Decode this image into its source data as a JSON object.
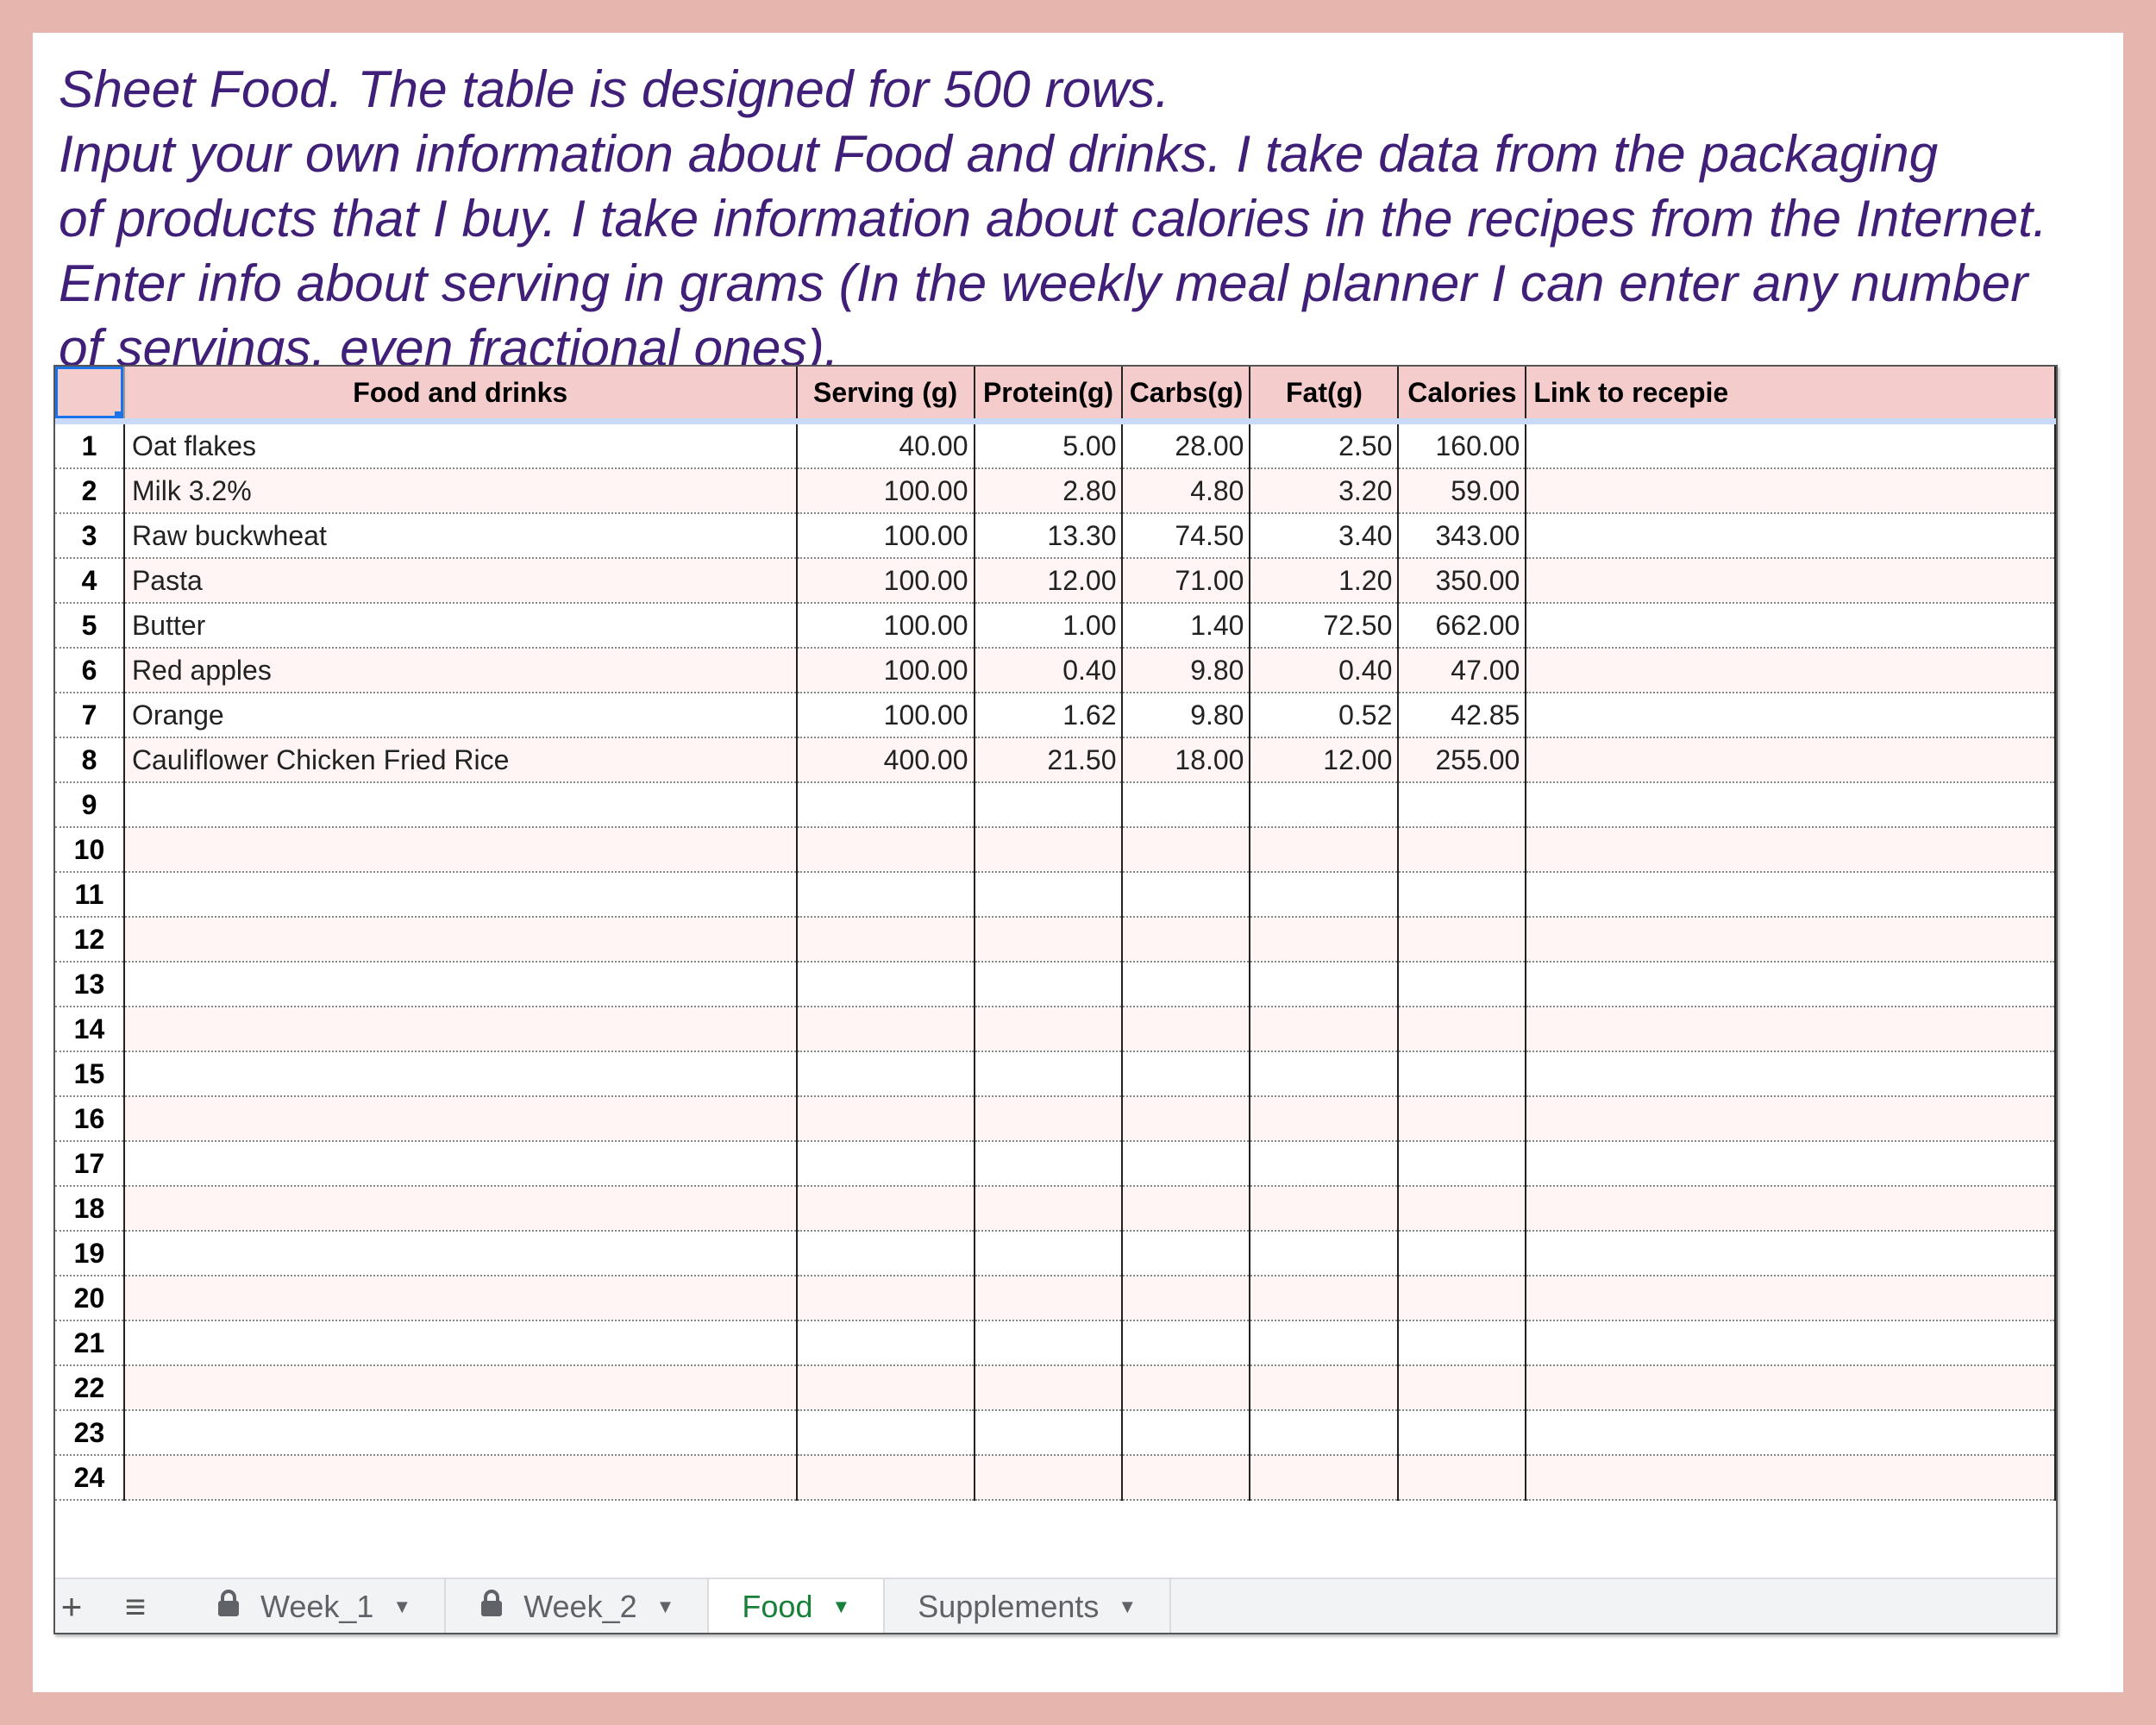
{
  "intro_lines": [
    "Sheet Food. The table is designed for 500 rows.",
    "Input your own information about Food and drinks. I take data from the packaging",
    "of products that I buy. I take information about calories in the recipes from the Internet.",
    "Enter info about serving in grams (In the weekly meal planner I can enter any number",
    "of servings, even fractional ones)."
  ],
  "table": {
    "headers": [
      "Food and drinks",
      "Serving (g)",
      "Protein(g)",
      "Carbs(g)",
      "Fat(g)",
      "Calories",
      "Link to recepie"
    ],
    "rows": [
      {
        "n": "1",
        "food": "Oat flakes",
        "serving": "40.00",
        "protein": "5.00",
        "carbs": "28.00",
        "fat": "2.50",
        "calories": "160.00",
        "link": ""
      },
      {
        "n": "2",
        "food": "Milk 3.2%",
        "serving": "100.00",
        "protein": "2.80",
        "carbs": "4.80",
        "fat": "3.20",
        "calories": "59.00",
        "link": ""
      },
      {
        "n": "3",
        "food": "Raw buckwheat",
        "serving": "100.00",
        "protein": "13.30",
        "carbs": "74.50",
        "fat": "3.40",
        "calories": "343.00",
        "link": ""
      },
      {
        "n": "4",
        "food": "Pasta",
        "serving": "100.00",
        "protein": "12.00",
        "carbs": "71.00",
        "fat": "1.20",
        "calories": "350.00",
        "link": ""
      },
      {
        "n": "5",
        "food": "Butter",
        "serving": "100.00",
        "protein": "1.00",
        "carbs": "1.40",
        "fat": "72.50",
        "calories": "662.00",
        "link": ""
      },
      {
        "n": "6",
        "food": "Red apples",
        "serving": "100.00",
        "protein": "0.40",
        "carbs": "9.80",
        "fat": "0.40",
        "calories": "47.00",
        "link": ""
      },
      {
        "n": "7",
        "food": "Orange",
        "serving": "100.00",
        "protein": "1.62",
        "carbs": "9.80",
        "fat": "0.52",
        "calories": "42.85",
        "link": ""
      },
      {
        "n": "8",
        "food": "Cauliflower Chicken Fried Rice",
        "serving": "400.00",
        "protein": "21.50",
        "carbs": "18.00",
        "fat": "12.00",
        "calories": "255.00",
        "link": ""
      },
      {
        "n": "9",
        "food": "",
        "serving": "",
        "protein": "",
        "carbs": "",
        "fat": "",
        "calories": "",
        "link": ""
      },
      {
        "n": "10",
        "food": "",
        "serving": "",
        "protein": "",
        "carbs": "",
        "fat": "",
        "calories": "",
        "link": ""
      },
      {
        "n": "11",
        "food": "",
        "serving": "",
        "protein": "",
        "carbs": "",
        "fat": "",
        "calories": "",
        "link": ""
      },
      {
        "n": "12",
        "food": "",
        "serving": "",
        "protein": "",
        "carbs": "",
        "fat": "",
        "calories": "",
        "link": ""
      },
      {
        "n": "13",
        "food": "",
        "serving": "",
        "protein": "",
        "carbs": "",
        "fat": "",
        "calories": "",
        "link": ""
      },
      {
        "n": "14",
        "food": "",
        "serving": "",
        "protein": "",
        "carbs": "",
        "fat": "",
        "calories": "",
        "link": ""
      },
      {
        "n": "15",
        "food": "",
        "serving": "",
        "protein": "",
        "carbs": "",
        "fat": "",
        "calories": "",
        "link": ""
      },
      {
        "n": "16",
        "food": "",
        "serving": "",
        "protein": "",
        "carbs": "",
        "fat": "",
        "calories": "",
        "link": ""
      },
      {
        "n": "17",
        "food": "",
        "serving": "",
        "protein": "",
        "carbs": "",
        "fat": "",
        "calories": "",
        "link": ""
      },
      {
        "n": "18",
        "food": "",
        "serving": "",
        "protein": "",
        "carbs": "",
        "fat": "",
        "calories": "",
        "link": ""
      },
      {
        "n": "19",
        "food": "",
        "serving": "",
        "protein": "",
        "carbs": "",
        "fat": "",
        "calories": "",
        "link": ""
      },
      {
        "n": "20",
        "food": "",
        "serving": "",
        "protein": "",
        "carbs": "",
        "fat": "",
        "calories": "",
        "link": ""
      },
      {
        "n": "21",
        "food": "",
        "serving": "",
        "protein": "",
        "carbs": "",
        "fat": "",
        "calories": "",
        "link": ""
      },
      {
        "n": "22",
        "food": "",
        "serving": "",
        "protein": "",
        "carbs": "",
        "fat": "",
        "calories": "",
        "link": ""
      },
      {
        "n": "23",
        "food": "",
        "serving": "",
        "protein": "",
        "carbs": "",
        "fat": "",
        "calories": "",
        "link": ""
      },
      {
        "n": "24",
        "food": "",
        "serving": "",
        "protein": "",
        "carbs": "",
        "fat": "",
        "calories": "",
        "link": ""
      }
    ]
  },
  "tabs": {
    "add_icon": "+",
    "menu_icon": "≡",
    "items": [
      {
        "label": "Week_1",
        "locked": true,
        "active": false
      },
      {
        "label": "Week_2",
        "locked": true,
        "active": false
      },
      {
        "label": "Food",
        "locked": false,
        "active": true
      },
      {
        "label": "Supplements",
        "locked": false,
        "active": false
      }
    ]
  },
  "colors": {
    "background": "#e6b5ae",
    "intro_text": "#3f1f78",
    "header_fill": "#f4cccc",
    "active_tab": "#188038",
    "selection": "#1a73e8"
  }
}
